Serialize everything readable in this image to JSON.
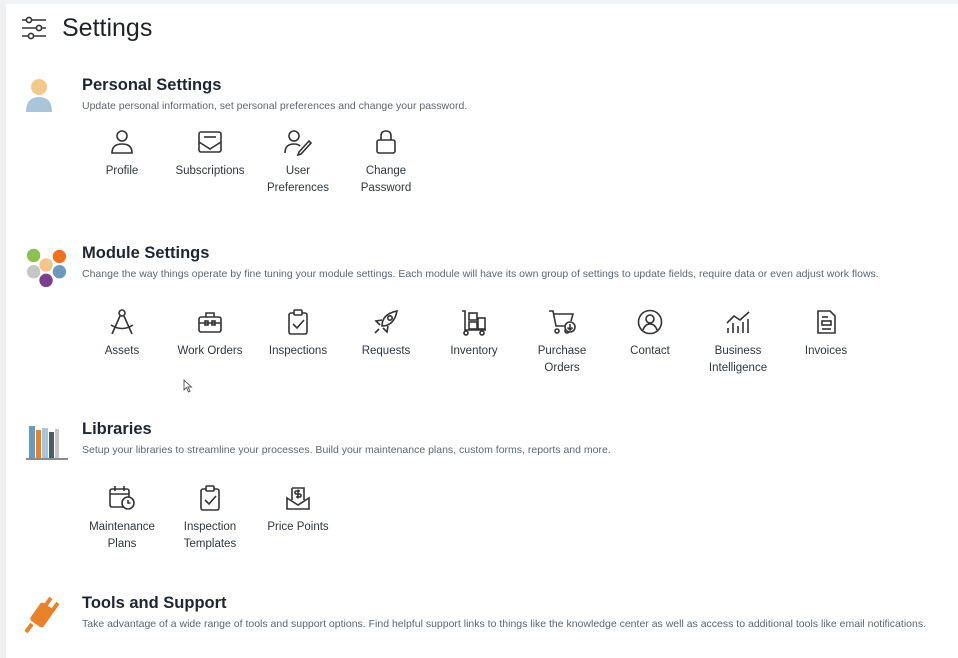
{
  "header": {
    "title": "Settings",
    "icon": "sliders-icon"
  },
  "sections": [
    {
      "title": "Personal Settings",
      "description": "Update personal information, set personal preferences and change your password.",
      "icon": "person-avatar-icon",
      "items": [
        {
          "label": "Profile",
          "icon": "user-icon"
        },
        {
          "label": "Subscriptions",
          "icon": "mail-inbox-icon"
        },
        {
          "label": "User Preferences",
          "icon": "user-edit-icon"
        },
        {
          "label": "Change Password",
          "icon": "lock-icon"
        }
      ]
    },
    {
      "title": "Module Settings",
      "description": "Change the way things operate by fine tuning your module settings. Each module will have its own group of settings to update fields, require data or even adjust work flows.",
      "icon": "hexagon-cluster-icon",
      "items": [
        {
          "label": "Assets",
          "icon": "compass-icon"
        },
        {
          "label": "Work Orders",
          "icon": "toolbox-icon"
        },
        {
          "label": "Inspections",
          "icon": "clipboard-check-icon"
        },
        {
          "label": "Requests",
          "icon": "rocket-icon"
        },
        {
          "label": "Inventory",
          "icon": "dolly-icon"
        },
        {
          "label": "Purchase Orders",
          "icon": "cart-download-icon"
        },
        {
          "label": "Contact",
          "icon": "user-circle-icon"
        },
        {
          "label": "Business Intelligence",
          "icon": "chart-line-icon"
        },
        {
          "label": "Invoices",
          "icon": "invoice-icon"
        }
      ]
    },
    {
      "title": "Libraries",
      "description": "Setup your libraries to streamline your processes. Build your maintenance plans, custom forms, reports and more.",
      "icon": "books-icon",
      "items": [
        {
          "label": "Maintenance Plans",
          "icon": "calendar-clock-icon"
        },
        {
          "label": "Inspection Templates",
          "icon": "clipboard-check-icon"
        },
        {
          "label": "Price Points",
          "icon": "dollar-tray-icon"
        }
      ]
    },
    {
      "title": "Tools and Support",
      "description": "Take advantage of a wide range of tools and support options. Find helpful support links to things like the knowledge center as well as access to additional tools like email notifications.",
      "icon": "plug-icon",
      "items": []
    }
  ],
  "colors": {
    "accent_orange": "#e8812a",
    "text": "#1f2630",
    "muted": "#5e6670"
  }
}
